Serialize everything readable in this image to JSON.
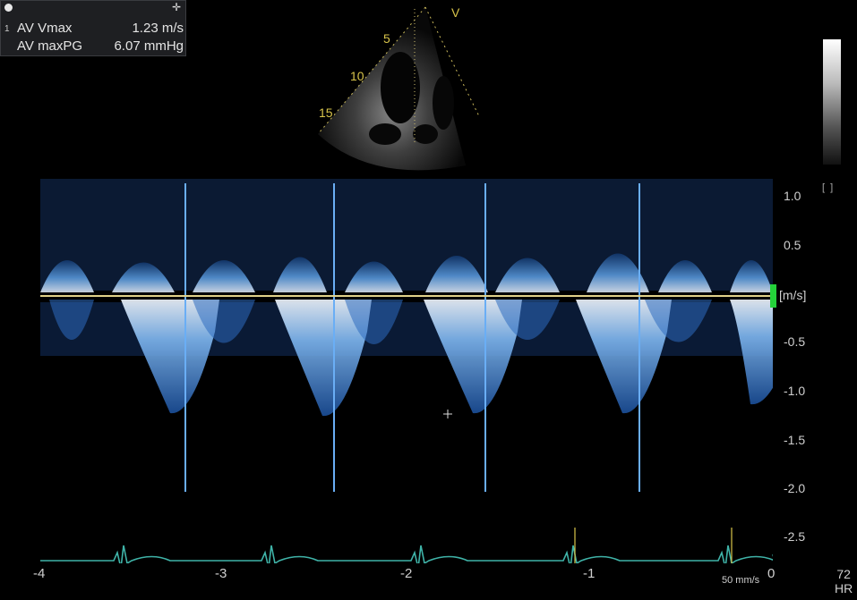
{
  "measurements": {
    "index": "1",
    "rows": [
      {
        "label": "AV Vmax",
        "value": "1.23 m/s"
      },
      {
        "label": "AV maxPG",
        "value": "6.07 mmHg"
      }
    ],
    "icons": [
      "circle-icon",
      "move-cross-icon"
    ]
  },
  "thumbnail": {
    "marker": "V",
    "depth_labels": [
      "5",
      "10",
      "15"
    ]
  },
  "velocity_axis": {
    "unit": "[m/s]",
    "ticks": [
      "1.0",
      "0.5",
      "-0.5",
      "-1.0",
      "-1.5",
      "-2.0",
      "-2.5"
    ]
  },
  "time_axis": {
    "ticks": [
      "-4",
      "-3",
      "-2",
      "-1",
      "0"
    ],
    "speed": "50 mm/s"
  },
  "heart_rate": {
    "value": "72",
    "label": "HR"
  },
  "colors": {
    "doppler": "#3a8fe0",
    "ecg": "#3fb3a8",
    "baseline": "#e2d28a",
    "gain_marker": "#24d13a"
  }
}
